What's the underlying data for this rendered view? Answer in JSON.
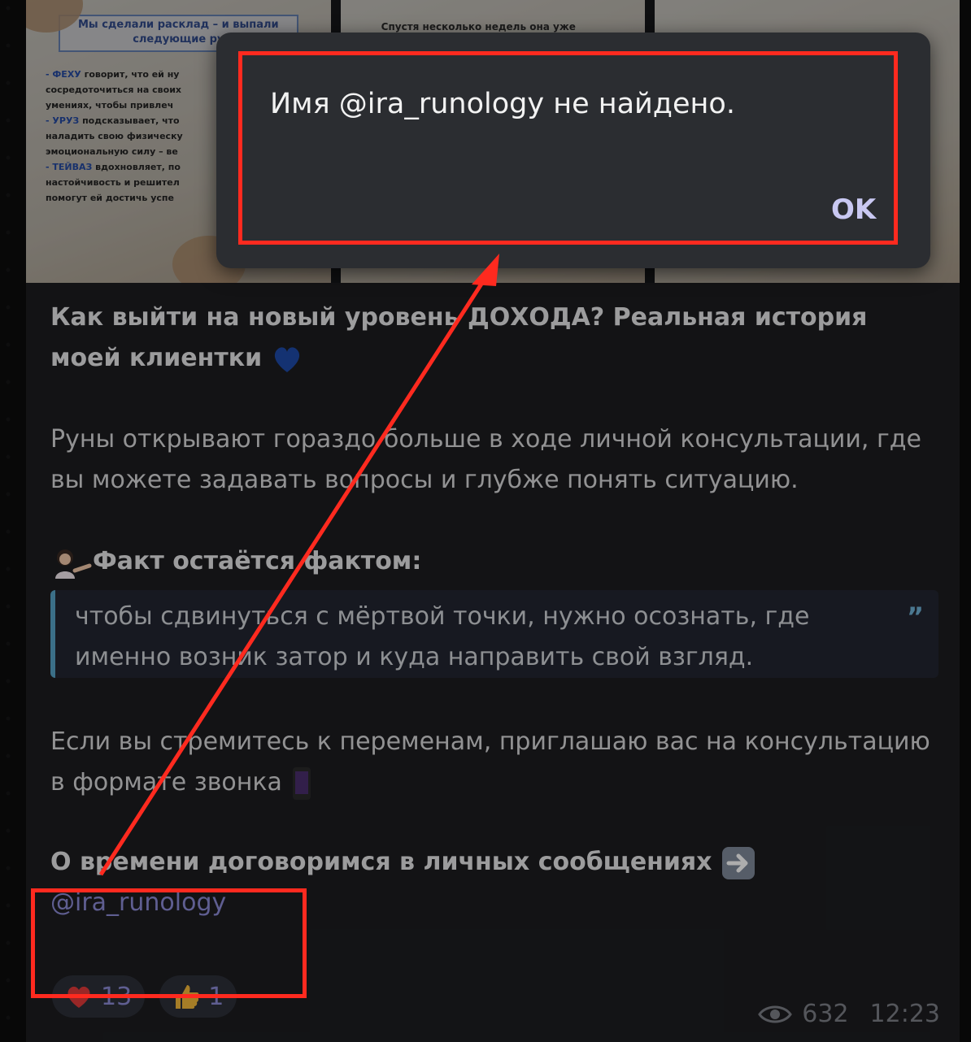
{
  "images": {
    "tile1": {
      "box_text": "Мы сделали расклад – и выпали следующие ру",
      "lines": [
        {
          "hl": "- ФЕХУ",
          "rest": " говорит, что ей ну"
        },
        {
          "hl": "",
          "rest": "сосредоточиться на своих"
        },
        {
          "hl": "",
          "rest": "умениях, чтобы привлеч"
        },
        {
          "hl": "- УРУЗ",
          "rest": " подсказывает, что"
        },
        {
          "hl": "",
          "rest": "наладить свою физическу"
        },
        {
          "hl": "",
          "rest": "эмоциональную силу – ве"
        },
        {
          "hl": "- ТЕЙВАЗ",
          "rest": " вдохновляет, по"
        },
        {
          "hl": "",
          "rest": "настойчивость и решител"
        },
        {
          "hl": "",
          "rest": "помогут ей достичь успе"
        }
      ]
    },
    "tile2": {
      "caption": "Спустя несколько недель она уже"
    }
  },
  "post": {
    "title": "Как выйти на новый уровень ДОХОДА? Реальная история моей клиентки",
    "paragraph1": "Руны открывают гораздо больше в ходе личной консультации, где вы можете задавать вопросы и глубже понять ситуацию.",
    "fact_heading": "Факт остаётся фактом:",
    "quote": "чтобы сдвинуться с мёртвой точки, нужно осознать, где именно возник затор и куда направить свой взгляд.",
    "paragraph2": "Если вы стремитесь к переменам, приглашаю вас на консультацию в формате звонка",
    "paragraph3": "О времени договоримся в личных сообщениях",
    "mention": "@ira_runology"
  },
  "reactions": [
    {
      "icon": "heart-icon",
      "count": "13"
    },
    {
      "icon": "thumbs-up-icon",
      "count": "1"
    }
  ],
  "meta": {
    "views": "632",
    "time": "12:23"
  },
  "dialog": {
    "message": "Имя @ira_runology не найдено.",
    "ok_label": "OK"
  },
  "colors": {
    "annotation_red": "#ff2a1f",
    "mention": "#8c8bd6",
    "quote_border": "#58a4c9"
  }
}
